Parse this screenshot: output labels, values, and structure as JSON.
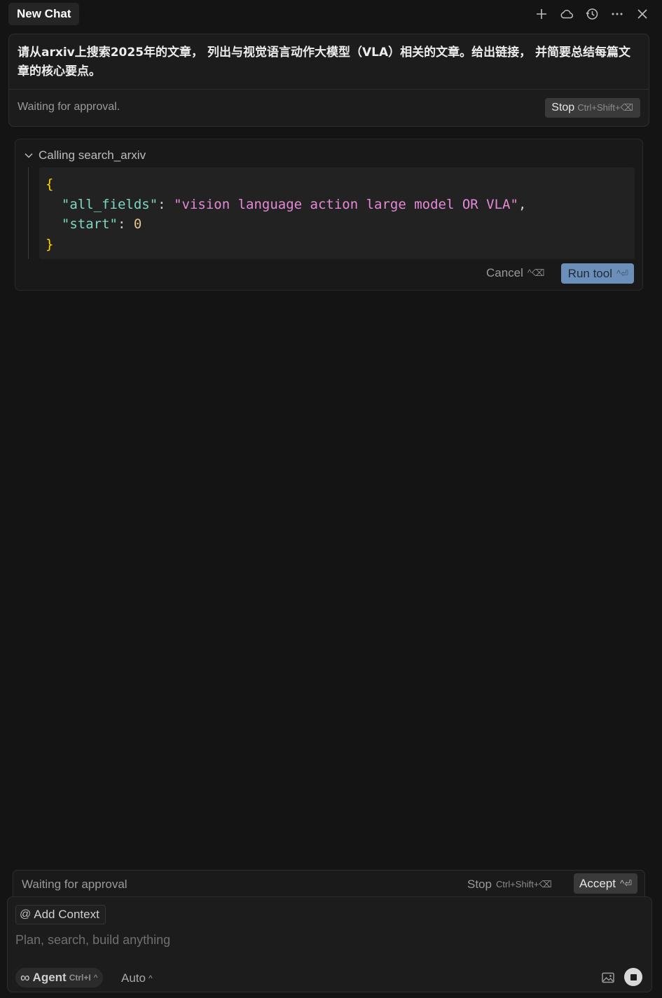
{
  "header": {
    "tab_title": "New Chat",
    "icons": [
      "plus-icon",
      "cloud-icon",
      "history-icon",
      "more-icon",
      "close-icon"
    ]
  },
  "user_message": {
    "text": "请从arxiv上搜索2025年的文章， 列出与视觉语言动作大模型（VLA）相关的文章。给出链接， 并简要总结每篇文章的核心要点。",
    "status": "Waiting for approval.",
    "stop_label": "Stop",
    "stop_shortcut": "Ctrl+Shift+⌫"
  },
  "tool_call": {
    "title": "Calling search_arxiv",
    "code": {
      "open_brace": "{",
      "key1": "\"all_fields\"",
      "value1": "\"vision language action large model OR VLA\"",
      "key2": "\"start\"",
      "value2": "0",
      "close_brace": "}"
    },
    "cancel_label": "Cancel",
    "cancel_shortcut": "^⌫",
    "run_label": "Run tool",
    "run_shortcut": "^⏎"
  },
  "approval_bar": {
    "status": "Waiting for approval",
    "stop_label": "Stop",
    "stop_shortcut": "Ctrl+Shift+⌫",
    "accept_label": "Accept",
    "accept_shortcut": "^⏎"
  },
  "composer": {
    "add_context_label": "Add Context",
    "placeholder": "Plan, search, build anything",
    "mode_label": "Agent",
    "mode_shortcut": "Ctrl+I",
    "model_label": "Auto"
  },
  "colors": {
    "background": "#141414",
    "run_button": "#6b8fb8",
    "json_key": "#7fd6c2",
    "json_string": "#e58ad6",
    "json_brace": "#ffd700"
  }
}
